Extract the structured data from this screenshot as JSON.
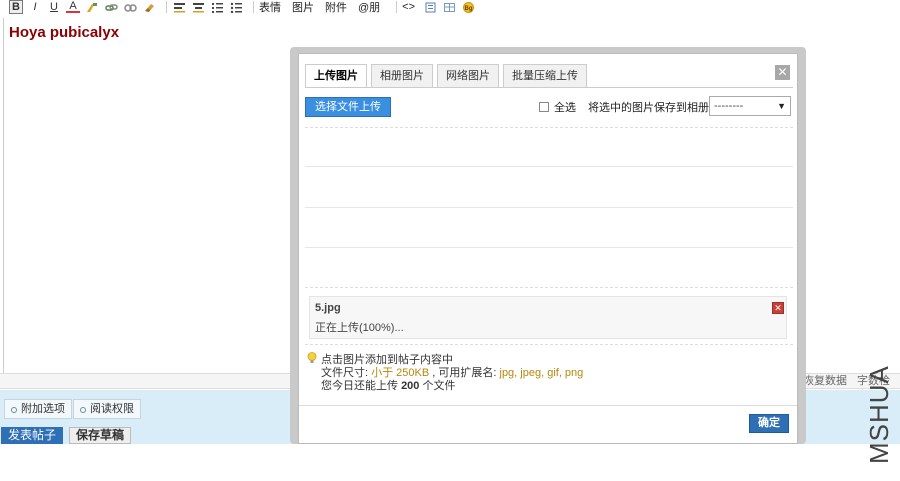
{
  "toolbar": {
    "buttons": [
      "B",
      "I",
      "U",
      "A"
    ],
    "text_items": [
      "表情",
      "图片",
      "附件",
      "@朋"
    ],
    "code_label": "<>"
  },
  "editor": {
    "title": "Hoya pubicalyx"
  },
  "status_bar": {
    "restore_label": "恢复数据",
    "wordcount_label": "字数检查"
  },
  "options": {
    "extra_label": "附加选项",
    "read_perm_label": "阅读权限"
  },
  "actions": {
    "post_label": "发表帖子",
    "draft_label": "保存草稿"
  },
  "dialog": {
    "tabs": [
      {
        "label": "上传图片",
        "active": true
      },
      {
        "label": "相册图片",
        "active": false
      },
      {
        "label": "网络图片",
        "active": false
      },
      {
        "label": "批量压缩上传",
        "active": false
      }
    ],
    "close_label": "✕",
    "upload_button": "选择文件上传",
    "select_all_label": "全选",
    "save_to_album_label": "将选中的图片保存到相册:",
    "album_value": "--------",
    "file": {
      "name": "5.jpg",
      "status": "正在上传(100%)...",
      "delete_label": "✕"
    },
    "tips": {
      "line1": "点击图片添加到帖子内容中",
      "line2_prefix": "文件尺寸: ",
      "line2_size": "小于 250KB",
      "line2_mid": " , 可用扩展名: ",
      "line2_ext": "jpg, jpeg, gif, png",
      "line3_prefix": "您今日还能上传 ",
      "line3_count": "200",
      "line3_suffix": " 个文件"
    },
    "confirm_label": "确定"
  },
  "watermark": "MSHUA",
  "colors": {
    "title": "#8b0000",
    "primary_button": "#2e6fb5",
    "highlight": "#b8860b",
    "delete": "#c9403a"
  }
}
